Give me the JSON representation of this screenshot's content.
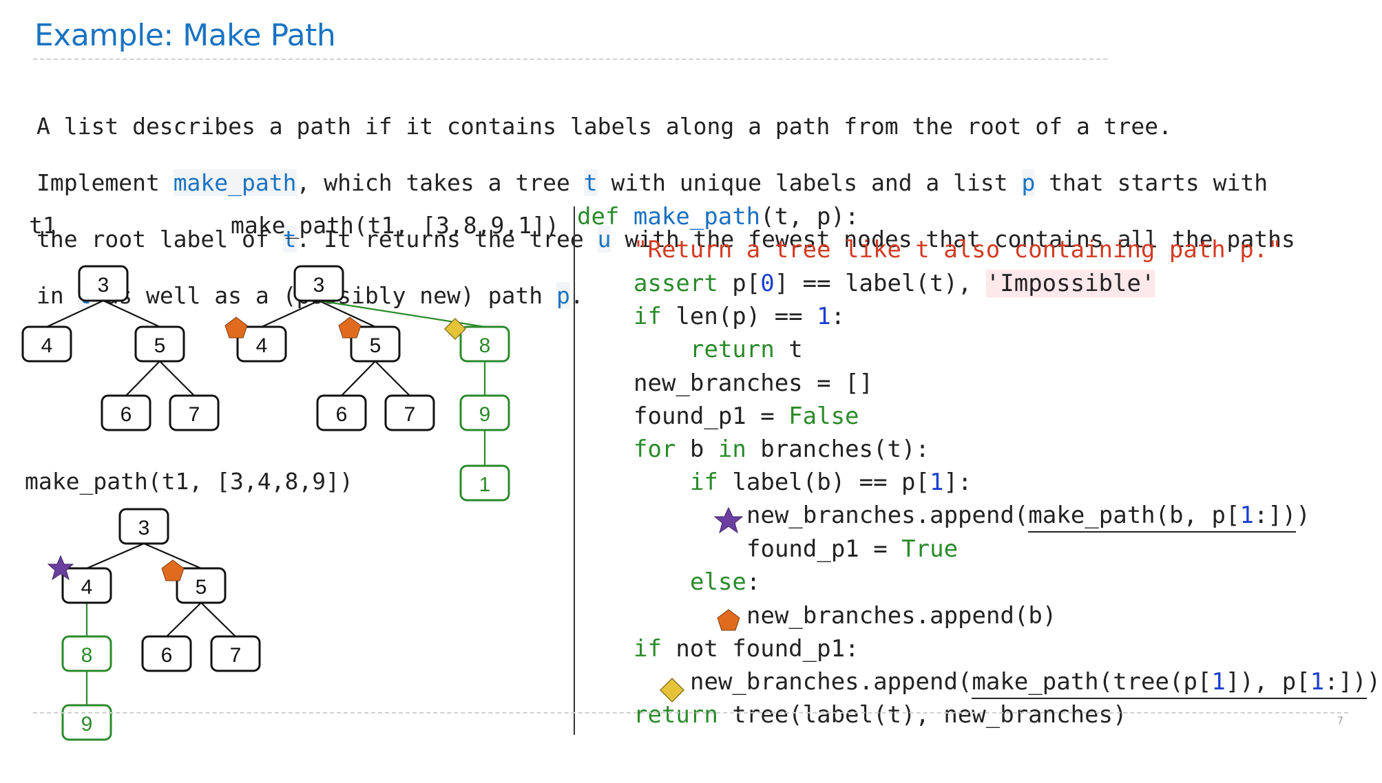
{
  "slide": {
    "title": "Example: Make Path",
    "page_number": "7"
  },
  "intro": {
    "line1": "A list describes a path if it contains labels along a path from the root of a tree.",
    "line2": [
      "Implement ",
      "make_path",
      ", which takes a tree ",
      "t",
      " with unique labels and a list ",
      "p",
      " that starts with"
    ],
    "line3": [
      "the root label of ",
      "t",
      ". It returns the tree ",
      "u",
      " with the fewest nodes that contains all the paths"
    ],
    "line4": [
      "in ",
      "t",
      " as well as a (possibly new) path ",
      "p",
      "."
    ]
  },
  "labels": {
    "t1": "t1",
    "call1": "make_path(t1, [3,8,9,1])",
    "call2": "make_path(t1, [3,4,8,9])"
  },
  "colors": {
    "green": "#2a8a2a",
    "black": "#111111",
    "orange": "#e06b1e",
    "yellow": "#e6c43a",
    "purple": "#6b3fa0"
  },
  "tree_t1": {
    "nodes": [
      "3",
      "4",
      "5",
      "6",
      "7"
    ],
    "edges": [
      [
        "3",
        "4"
      ],
      [
        "3",
        "5"
      ],
      [
        "5",
        "6"
      ],
      [
        "5",
        "7"
      ]
    ]
  },
  "tree_path1": {
    "nodes": [
      "3",
      "4",
      "5",
      "6",
      "7",
      "8",
      "9",
      "1"
    ],
    "new_nodes": [
      "8",
      "9",
      "1"
    ],
    "markers": {
      "4": "pentagon",
      "5": "pentagon",
      "8": "diamond"
    }
  },
  "tree_path2": {
    "nodes": [
      "3",
      "4",
      "5",
      "6",
      "7",
      "8",
      "9"
    ],
    "new_nodes": [
      "8",
      "9"
    ],
    "markers": {
      "4": "star",
      "5": "pentagon"
    }
  },
  "code": {
    "l1": {
      "kw": "def",
      "name": "make_path",
      "rest": "(t, p):"
    },
    "l2": {
      "str": "\"Return a tree like t also containing path p.\""
    },
    "l3": {
      "kw": "assert",
      "a": " p[",
      "n0": "0",
      "b": "] == label(t), ",
      "str": "'Impossible'"
    },
    "l4": {
      "kw": "if",
      "a": " len(p) == ",
      "n1": "1",
      "b": ":"
    },
    "l5": {
      "kw": "return",
      "a": " t"
    },
    "l6": {
      "a": "new_branches = []"
    },
    "l7": {
      "a": "found_p1 = ",
      "kw": "False"
    },
    "l8": {
      "kw": "for",
      "a": " b ",
      "kw2": "in",
      "b": " branches(t):"
    },
    "l9": {
      "kw": "if",
      "a": " label(b) == p[",
      "n1": "1",
      "b": "]:"
    },
    "l10": {
      "a": "new_branches.append(",
      "blank_a": "make_path(b, p[",
      "n1": "1",
      "blank_b": ":])",
      "b": ")"
    },
    "l11": {
      "a": "found_p1 = ",
      "kw": "True"
    },
    "l12": {
      "kw": "else",
      "a": ":"
    },
    "l13": {
      "a": "new_branches.append(b)"
    },
    "l14": {
      "kw": "if",
      "a": " not found_p1:"
    },
    "l15": {
      "a": "new_branches.append(",
      "blank_a": "make_path(tree(p[",
      "n1": "1",
      "blank_b": "]), p[",
      "n1b": "1",
      "blank_c": ":])",
      "b": ")"
    },
    "l16": {
      "kw": "return",
      "a": " tree(label(t), new_branches)"
    }
  }
}
